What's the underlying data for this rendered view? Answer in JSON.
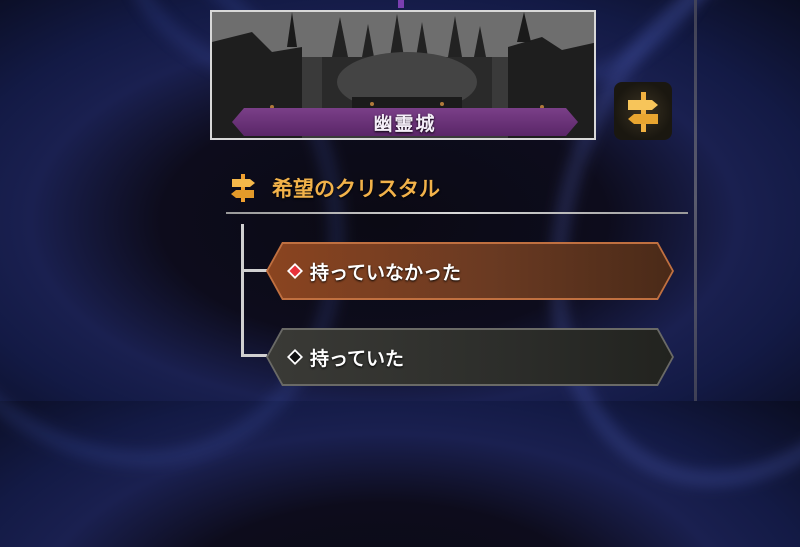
{
  "location": {
    "name": "幽霊城"
  },
  "question": {
    "label": "希望のクリスタル"
  },
  "options": [
    {
      "label": "持っていなかった",
      "selected": true
    },
    {
      "label": "持っていた",
      "selected": false
    }
  ],
  "colors": {
    "accent_gold": "#f2b24a",
    "selected_option": "#8a4420",
    "unselected_option": "#3a3a36",
    "banner_purple": "#6a2e78"
  },
  "icons": {
    "signpost": "signpost-icon",
    "diamond_selected": "red-diamond-icon",
    "diamond_unselected": "black-diamond-icon"
  }
}
